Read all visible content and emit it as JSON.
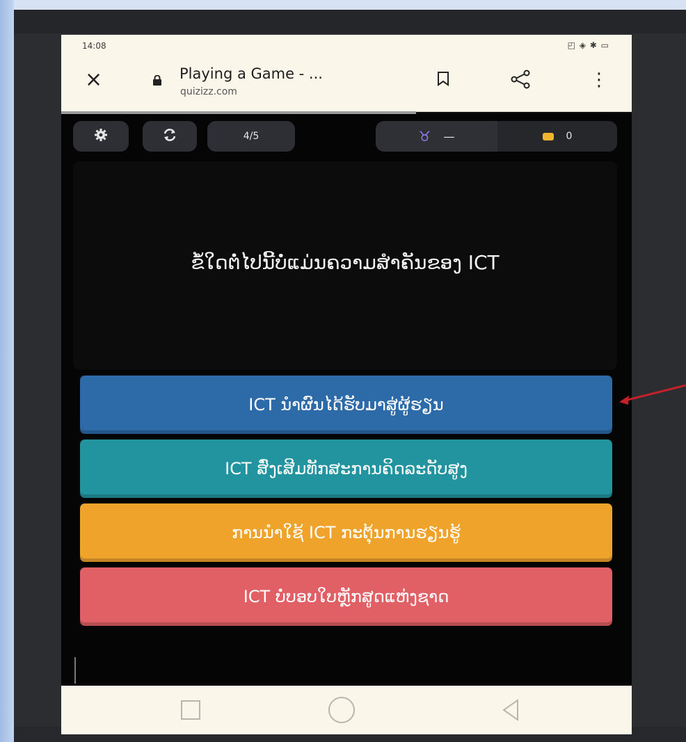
{
  "status_bar": {
    "time": "14:08",
    "system_icons": "◰ ◈ ✱ ▭"
  },
  "browser": {
    "close_icon": "×",
    "page_title": "Playing a Game - ...",
    "host": "quizizz.com",
    "menu_icon": "⋮"
  },
  "game_toolbar": {
    "question_counter": "4/5",
    "streak_value": "—",
    "coin_count": "0"
  },
  "question": {
    "text": "ຂໍ້ໃດຕໍ່ໄປນີ້ບໍ່ແມ່ນຄວາມສຳຄັນຂອງ ICT"
  },
  "options": [
    {
      "label": "ICT ນຳຜົນໄດ້ຮັບມາສູ່ຜູ້ຮຽນ",
      "color": "#2d6aa8"
    },
    {
      "label": "ICT ສົ່ງເສີມທັກສະການຄິດລະດັບສູງ",
      "color": "#2294a0"
    },
    {
      "label": "ການນຳໃຊ້ ICT ກະຕຸ້ນການຮຽນຮູ້",
      "color": "#f0a32a"
    },
    {
      "label": "ICT ບໍ່ບອບໃບຫຼັກສູດແຫ່ງຊາດ",
      "color": "#e06065"
    }
  ],
  "icons": {
    "settings": "gear-icon",
    "refresh": "refresh-icon",
    "streak": "streak-icon",
    "coins": "coin-stack-icon",
    "lock": "lock-icon",
    "bookmark": "bookmark-icon",
    "share": "share-icon",
    "nav_recents": "square-icon",
    "nav_home": "circle-icon",
    "nav_back": "triangle-back-icon"
  },
  "annotation_color": "#c4202a"
}
